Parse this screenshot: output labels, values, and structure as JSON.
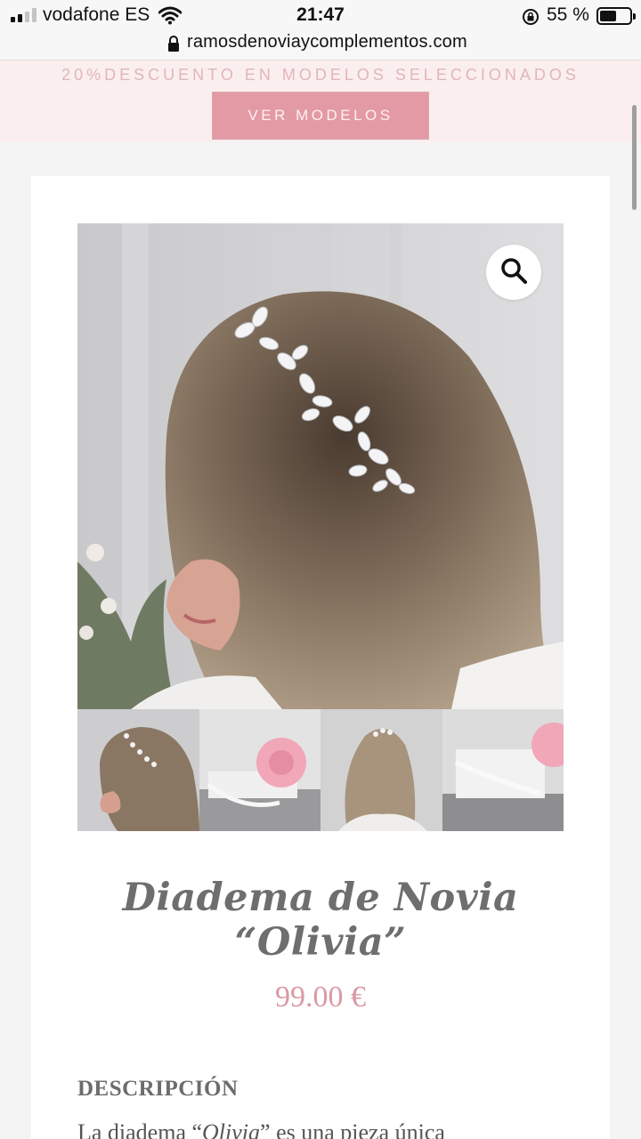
{
  "status_bar": {
    "carrier": "vodafone ES",
    "time": "21:47",
    "battery_percent": "55 %",
    "signal_bars": 2
  },
  "browser": {
    "url": "ramosdenoviaycomplementos.com"
  },
  "promo": {
    "text": "20%DESCUENTO EN MODELOS SELECCIONADOS",
    "button_label": "VER MODELOS"
  },
  "product": {
    "title": "Diadema de Novia “Olivia”",
    "price": "99.00 €",
    "description_heading": "DESCRIPCIÓN",
    "description_start": "La diadema “",
    "description_name": "Olivia",
    "description_rest": "” es una pieza única"
  },
  "icons": {
    "zoom": "magnifier-icon",
    "lock": "lock-icon",
    "wifi": "wifi-icon"
  },
  "colors": {
    "accent_pink": "#e39aa5",
    "price_pink": "#d99aa3",
    "banner_bg": "#fbeeee"
  }
}
